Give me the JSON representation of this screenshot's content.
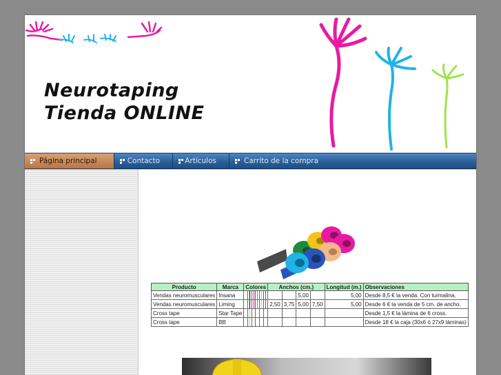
{
  "header": {
    "title_line1": "Neurotaping",
    "title_line2": "Tienda ONLINE"
  },
  "nav": {
    "items": [
      {
        "label": "Página principal",
        "active": true
      },
      {
        "label": "Contacto",
        "active": false
      },
      {
        "label": "Artículos",
        "active": false
      },
      {
        "label": "Carrito de la compra",
        "active": false
      }
    ]
  },
  "table": {
    "headers": {
      "producto": "Producto",
      "marca": "Marca",
      "colores": "Colores",
      "anchos": "Anchos (cm.)",
      "longitud": "Longitud (m.)",
      "observaciones": "Observaciones"
    },
    "rows": [
      {
        "producto": "Vendas neuromusculares",
        "marca": "Insana",
        "colors": [
          "#000000",
          "#e81aa3",
          "#1fb3e8",
          "#f4b98a",
          "#1e8b3c"
        ],
        "anchos": [
          "",
          "",
          "5,00",
          ""
        ],
        "longitud": "5,00",
        "observaciones": "Desde 8,5 € la venda. Con turmalina."
      },
      {
        "producto": "Vendas neuromusculares",
        "marca": "Liming",
        "colors": [
          "#000000",
          "#e81aa3",
          "#1fb3e8",
          "#f4b98a",
          "#1e8b3c"
        ],
        "anchos": [
          "2,50",
          "3,75",
          "5,00",
          "7,50"
        ],
        "longitud": "5,00",
        "observaciones": "Desde 6 € la venda de 5 cm. de ancho."
      },
      {
        "producto": "Cross tape",
        "marca": "Star Tape",
        "colors": [
          "#f4b98a"
        ],
        "anchos": [
          "",
          "",
          "",
          ""
        ],
        "longitud": "",
        "observaciones": "Desde 1,5 € la lámina de 6 cross."
      },
      {
        "producto": "Cross tape",
        "marca": "BB",
        "colors": [
          "#f4b98a"
        ],
        "anchos": [
          "",
          "",
          "",
          ""
        ],
        "longitud": "",
        "observaciones": "Desde 18 € la caja (30x6 ó 27x9 láminas)"
      }
    ]
  },
  "colors": {
    "magenta": "#e81aa3",
    "cyan": "#1fb3e8",
    "lime": "#9fe34a",
    "nav_blue": "#2c5f97",
    "nav_active": "#c8875a",
    "table_header": "#b8f0c4"
  },
  "icons": {
    "hands_art": "hand-figures-illustration",
    "tape_rolls": "tape-rolls-image",
    "worker": "construction-worker-helmet-image"
  }
}
